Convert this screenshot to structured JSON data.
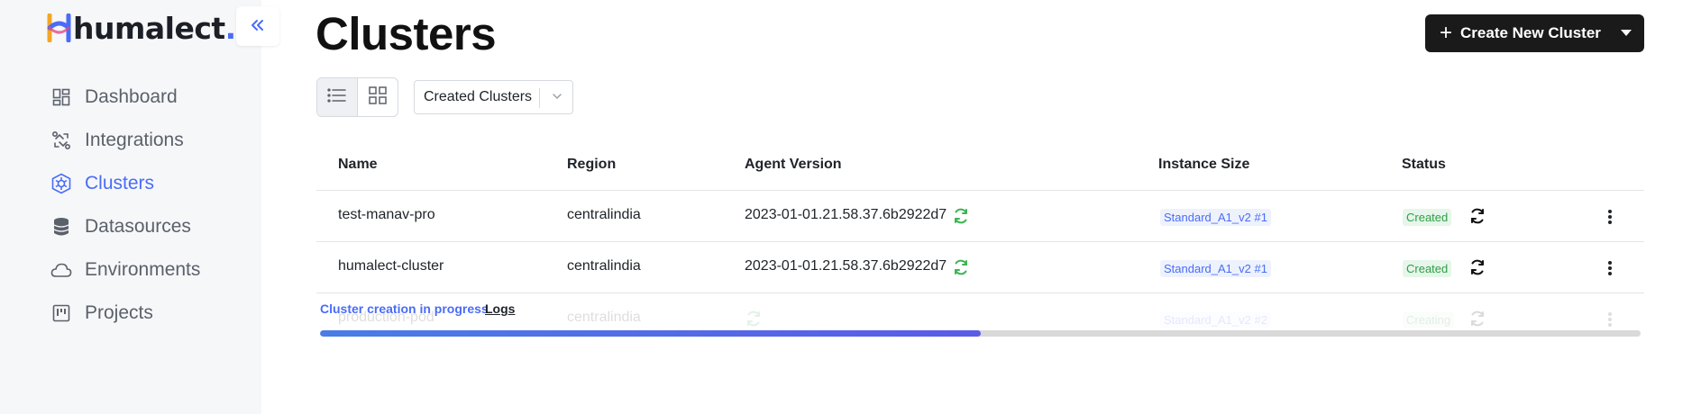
{
  "brand": {
    "name": "humalect",
    "dot": "."
  },
  "sidebar": {
    "collapse_icon": "double-chevron-left-icon",
    "items": [
      {
        "label": "Dashboard",
        "icon": "dashboard-icon",
        "active": false
      },
      {
        "label": "Integrations",
        "icon": "integrations-icon",
        "active": false
      },
      {
        "label": "Clusters",
        "icon": "clusters-icon",
        "active": true
      },
      {
        "label": "Datasources",
        "icon": "database-icon",
        "active": false
      },
      {
        "label": "Environments",
        "icon": "cloud-icon",
        "active": false
      },
      {
        "label": "Projects",
        "icon": "projects-icon",
        "active": false
      }
    ]
  },
  "header": {
    "title": "Clusters",
    "create_button": {
      "label": "Create New Cluster",
      "icon": "plus-icon"
    }
  },
  "toolbar": {
    "view_modes": [
      "list-view-icon",
      "grid-view-icon"
    ],
    "active_view": "list",
    "filter": {
      "value": "Created Clusters"
    }
  },
  "table": {
    "columns": [
      "Name",
      "Region",
      "Agent Version",
      "Instance Size",
      "Status"
    ],
    "rows": [
      {
        "name": "test-manav-pro",
        "region": "centralindia",
        "agent_version": "2023-01-01.21.58.37.6b2922d7",
        "instance_size": "Standard_A1_v2 #1",
        "status": "Created"
      },
      {
        "name": "humalect-cluster",
        "region": "centralindia",
        "agent_version": "2023-01-01.21.58.37.6b2922d7",
        "instance_size": "Standard_A1_v2 #1",
        "status": "Created"
      },
      {
        "name": "production-pod",
        "region": "centralindia",
        "agent_version": "",
        "instance_size": "Standard_A1_v2 #2",
        "status": "Creating"
      }
    ],
    "progress": {
      "text": "Cluster creation in progress",
      "logs_label": "Logs",
      "fraction": 0.5
    }
  },
  "colors": {
    "accent": "#4a6cf7",
    "success": "#2e9e46",
    "dark": "#1a1a1a",
    "sidebar_bg": "#f6f7f9"
  }
}
